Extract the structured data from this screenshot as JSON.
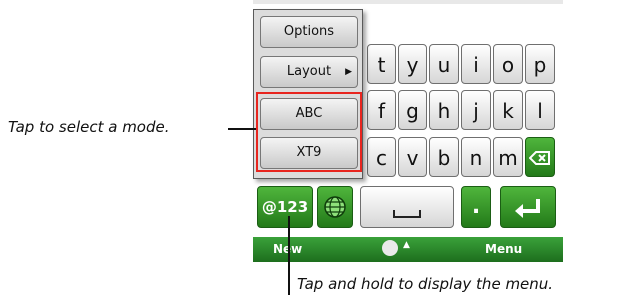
{
  "menu": {
    "options_label": "Options",
    "layout_label": "Layout",
    "abc_label": "ABC",
    "xt9_label": "XT9"
  },
  "keyboard": {
    "row1": [
      "t",
      "y",
      "u",
      "i",
      "o",
      "p"
    ],
    "row2": [
      "f",
      "g",
      "h",
      "j",
      "k",
      "l"
    ],
    "row3": [
      "c",
      "v",
      "b",
      "n",
      "m"
    ],
    "symbols_key_label": "@123",
    "period_key_label": ".",
    "backspace_icon": "backspace-icon",
    "enter_icon": "enter-icon",
    "globe_icon": "globe-icon",
    "space_icon": "space-icon"
  },
  "bottom_bar": {
    "left_label": "New",
    "right_label": "Menu",
    "input_indicator_icon": "input-indicator-icon"
  },
  "annotations": {
    "mode_callout": "Tap to select a mode.",
    "hold_callout": "Tap and hold to display the menu."
  },
  "colors": {
    "highlight": "#e8251f",
    "accent_green": "#2e8b26"
  }
}
